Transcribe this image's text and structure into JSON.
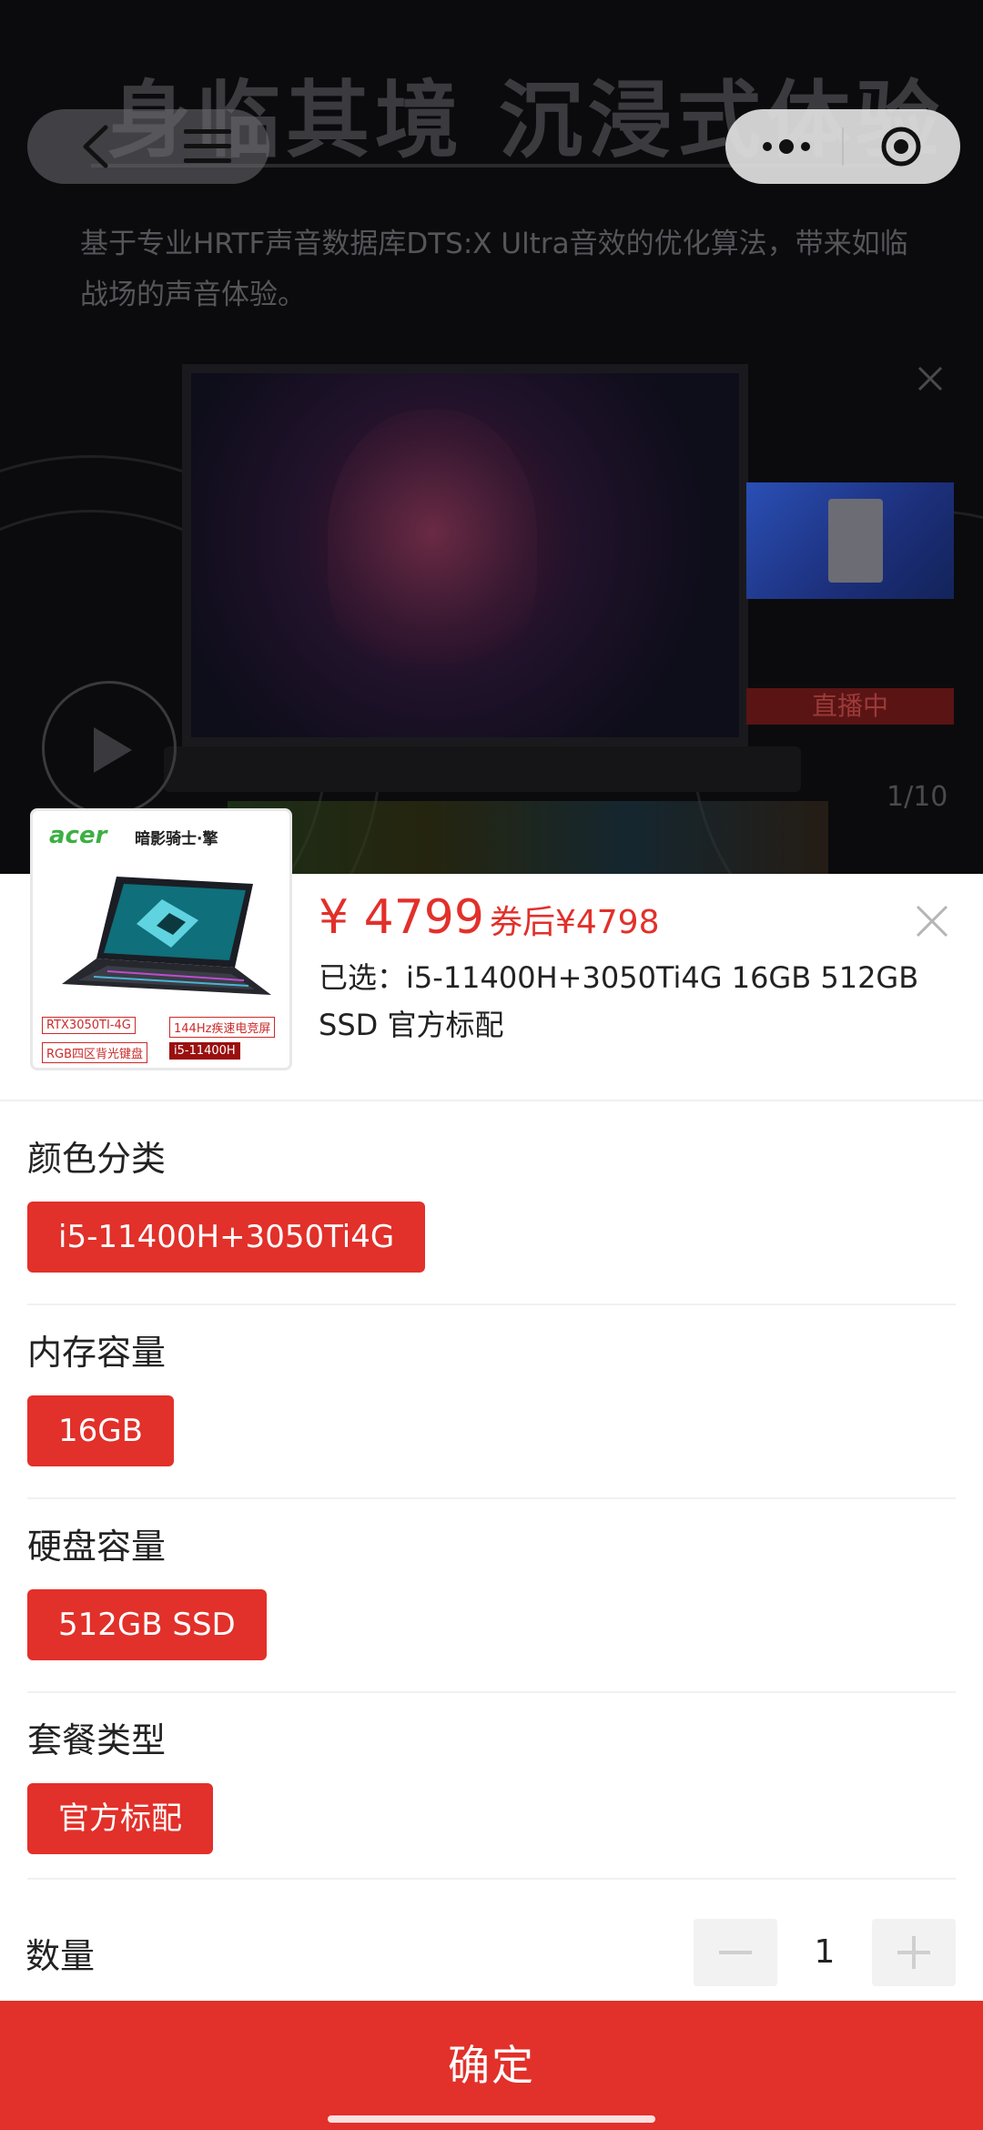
{
  "background": {
    "headline": "身临其境 沉浸式体验",
    "description": "基于专业HRTF声音数据库DTS:X Ultra音效的优化算法，带来如临战场的声音体验。",
    "live_badge": "直播中",
    "image_counter": "1/10"
  },
  "product": {
    "thumb_brand": "acer",
    "thumb_brand_cn": "暗影骑士·擎",
    "thumb_tags": [
      "RTX3050TI-4G",
      "144Hz疾速电竞屏",
      "RGB四区背光键盘",
      "i5-11400H"
    ],
    "price": "¥ 4799",
    "coupon_price": "券后¥4798",
    "selected_prefix": "已选：",
    "selected_value": "i5-11400H+3050Ti4G 16GB 512GB SSD 官方标配"
  },
  "groups": [
    {
      "title": "颜色分类",
      "option": "i5-11400H+3050Ti4G"
    },
    {
      "title": "内存容量",
      "option": "16GB"
    },
    {
      "title": "硬盘容量",
      "option": "512GB SSD"
    },
    {
      "title": "套餐类型",
      "option": "官方标配"
    }
  ],
  "quantity": {
    "label": "数量",
    "value": "1"
  },
  "confirm_label": "确定",
  "colors": {
    "accent": "#e2302a",
    "background_dark": "#0b0b0e"
  },
  "icons": [
    "back-arrow-icon",
    "menu-icon",
    "more-dots-icon",
    "target-icon",
    "close-icon",
    "play-icon",
    "minus-icon",
    "plus-icon"
  ]
}
